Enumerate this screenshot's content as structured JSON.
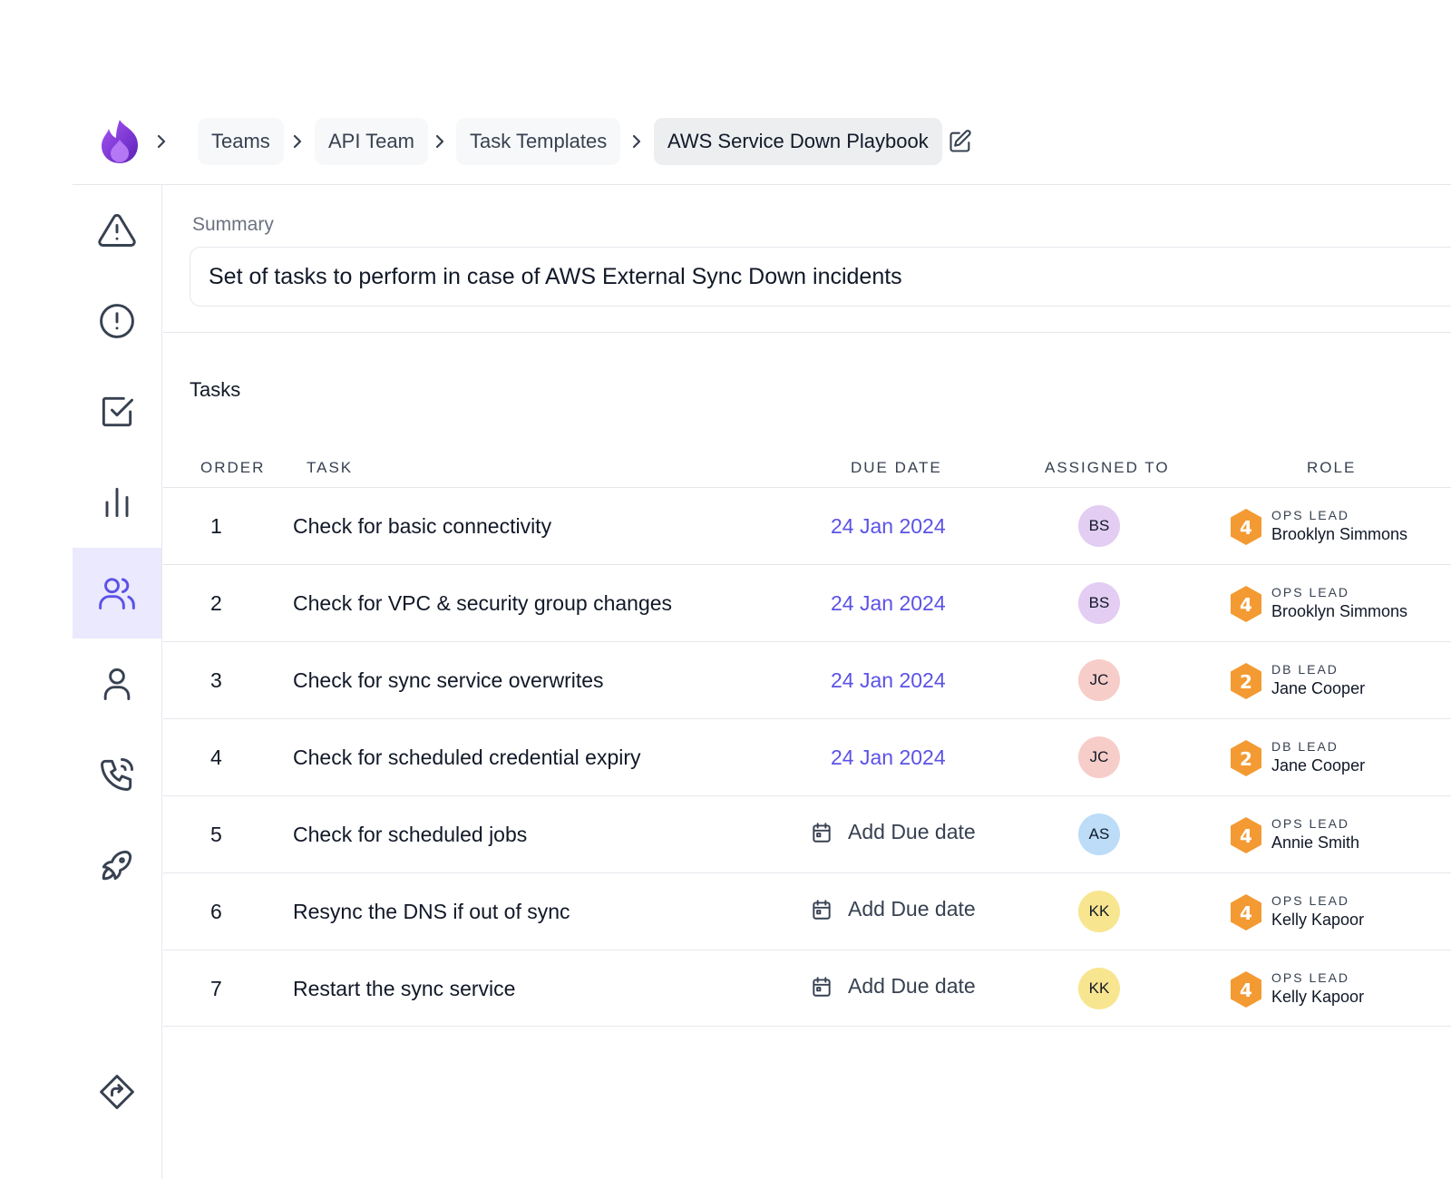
{
  "colors": {
    "accent": "#5b52e6",
    "nav_active_bg": "#ebe9fd",
    "role_badge": "#f39a33"
  },
  "breadcrumb": {
    "items": [
      {
        "label": "Teams"
      },
      {
        "label": "API Team"
      },
      {
        "label": "Task Templates"
      },
      {
        "label": "AWS Service Down Playbook"
      }
    ]
  },
  "sidebar": {
    "items": [
      {
        "icon": "alert-triangle-icon"
      },
      {
        "icon": "alert-circle-icon"
      },
      {
        "icon": "checkbox-icon"
      },
      {
        "icon": "bar-chart-icon"
      },
      {
        "icon": "users-icon",
        "active": true
      },
      {
        "icon": "user-icon"
      },
      {
        "icon": "phone-icon"
      },
      {
        "icon": "rocket-icon"
      },
      {
        "icon": "route-icon"
      }
    ]
  },
  "summary": {
    "label": "Summary",
    "value": "Set of tasks to perform in case of AWS External Sync Down incidents"
  },
  "tasks": {
    "heading": "Tasks",
    "columns": {
      "order": "ORDER",
      "task": "TASK",
      "due_date": "DUE DATE",
      "assigned_to": "ASSIGNED TO",
      "role": "ROLE"
    },
    "add_due_label": "Add Due date",
    "rows": [
      {
        "order": "1",
        "task": "Check for basic connectivity",
        "due": "24 Jan 2024",
        "initials": "BS",
        "avatar_color": "#e3cdf3",
        "role_title": "OPS LEAD",
        "role_name": "Brooklyn Simmons",
        "badge": "4"
      },
      {
        "order": "2",
        "task": "Check for VPC & security group changes",
        "due": "24 Jan 2024",
        "initials": "BS",
        "avatar_color": "#e3cdf3",
        "role_title": "OPS LEAD",
        "role_name": "Brooklyn Simmons",
        "badge": "4"
      },
      {
        "order": "3",
        "task": "Check for sync service overwrites",
        "due": "24 Jan 2024",
        "initials": "JC",
        "avatar_color": "#f7cdc9",
        "role_title": "DB LEAD",
        "role_name": "Jane Cooper",
        "badge": "2"
      },
      {
        "order": "4",
        "task": "Check for scheduled credential expiry",
        "due": "24 Jan 2024",
        "initials": "JC",
        "avatar_color": "#f7cdc9",
        "role_title": "DB LEAD",
        "role_name": "Jane Cooper",
        "badge": "2"
      },
      {
        "order": "5",
        "task": "Check for scheduled jobs",
        "due": "",
        "initials": "AS",
        "avatar_color": "#bcdcf7",
        "role_title": "OPS LEAD",
        "role_name": "Annie Smith",
        "badge": "4"
      },
      {
        "order": "6",
        "task": "Resync the DNS if out of sync",
        "due": "",
        "initials": "KK",
        "avatar_color": "#f8e58f",
        "role_title": "OPS LEAD",
        "role_name": "Kelly Kapoor",
        "badge": "4"
      },
      {
        "order": "7",
        "task": "Restart the sync service",
        "due": "",
        "initials": "KK",
        "avatar_color": "#f8e58f",
        "role_title": "OPS LEAD",
        "role_name": "Kelly Kapoor",
        "badge": "4"
      }
    ]
  }
}
